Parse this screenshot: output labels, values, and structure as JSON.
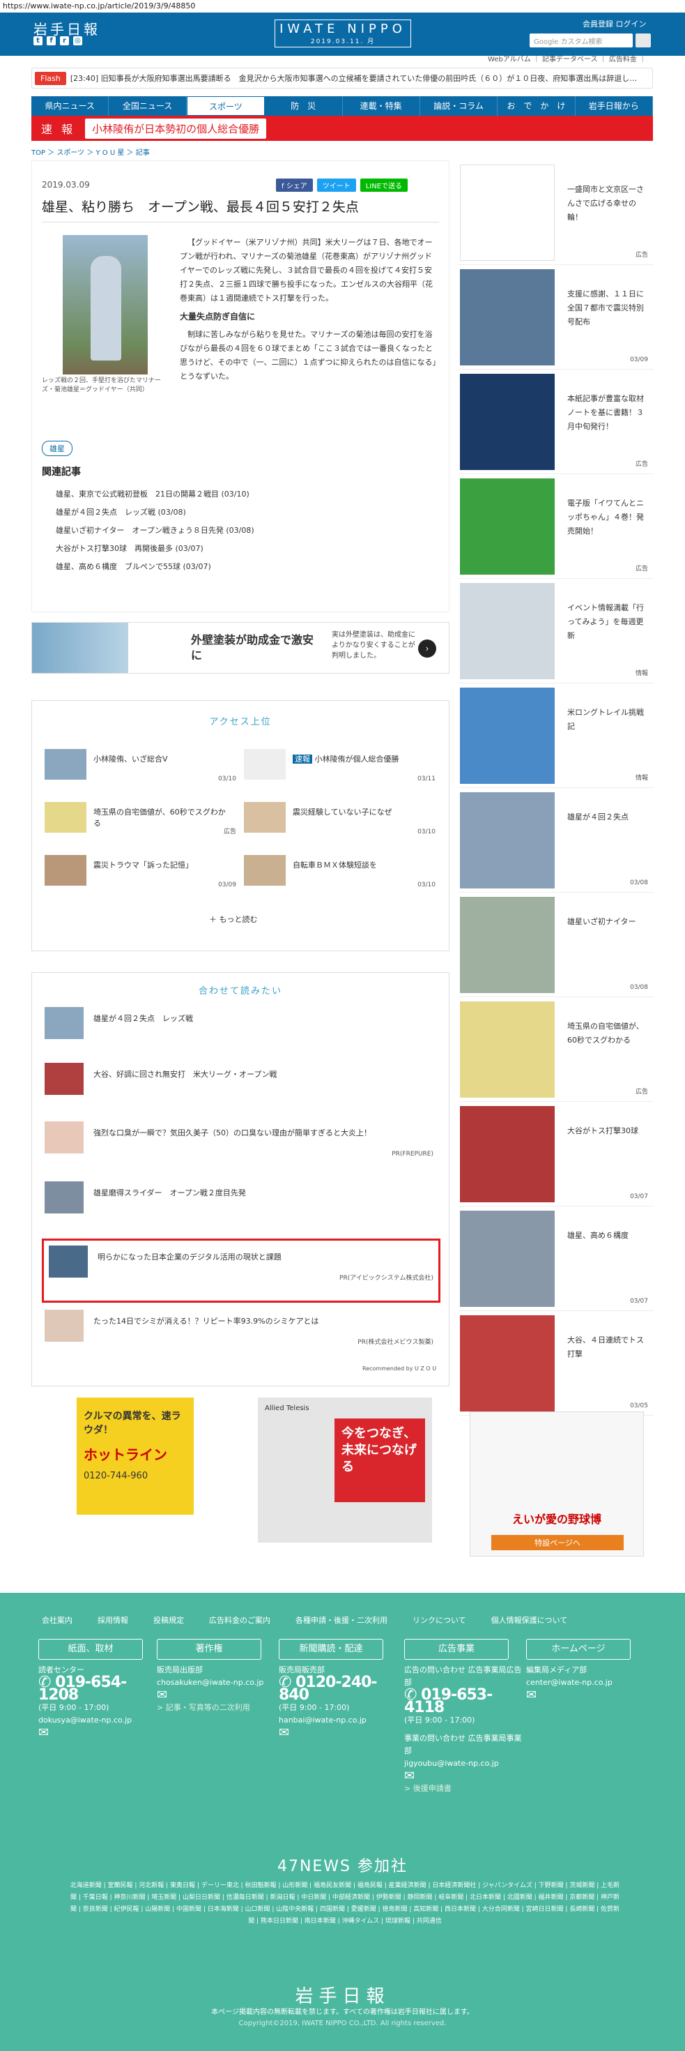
{
  "url": "https://www.iwate-np.co.jp/article/2019/3/9/48850",
  "header": {
    "logo": "岩手日報",
    "center_title": "IWATE NIPPO",
    "center_date": "2019.03.11. 月",
    "login": "会員登録  ログイン",
    "search_placeholder": "Google カスタム検索",
    "subnav": "Webアルバム ｜ 記事データベース ｜ 広告料金 ｜"
  },
  "flash": {
    "tag": "Flash",
    "text": "[23:40] 旧知事長が大阪府知事選出馬要請断る　金見沢から大阪市知事選への立候補を要請されていた俳優の前田吟氏（６０）が１０日夜、府知事選出馬は辞退し…"
  },
  "nav": [
    "県内ニュース",
    "全国ニュース",
    "スポーツ",
    "防　災",
    "連載・特集",
    "論説・コラム",
    "お　で　か　け",
    "岩手日報から"
  ],
  "breaking": {
    "label": "速 報",
    "text": "小林陵侑が日本勢初の個人総合優勝"
  },
  "breadcrumb": "TOP ＞ スポーツ ＞ Y O U 星 ＞ 記事",
  "article": {
    "date": "2019.03.09",
    "share": [
      "f シェア",
      "ツイート",
      "LINEで送る"
    ],
    "title": "雄星、粘り勝ち　オープン戦、最長４回５安打２失点",
    "caption": "レッズ戦の２回、手堅打を浴びたマリナーズ・菊池雄星＝グッドイヤー（共同）",
    "p1": "【グッドイヤー（米アリゾナ州）共同】米大リーグは７日、各地でオープン戦が行われ、マリナーズの菊池雄星（花巻東高）がアリゾナ州グッドイヤーでのレッズ戦に先発し、３試合目で最長の４回を投げて４安打５安打２失点、２三振１四球で勝ち投手になった。エンゼルスの大谷翔平（花巻東高）は１週間連続でトス打撃を行った。",
    "h": "大量失点防ぎ自信に",
    "p2": "制球に苦しみながら粘りを見せた。マリナーズの菊池は毎回の安打を浴びながら最長の４回を６０球でまとめ「ここ３試合では一番良くなったと思うけど、その中で（一、二回に）１点ずつに抑えられたのは自信になる」とうなずいた。",
    "tag": "雄星",
    "related_head": "関連記事",
    "related": [
      "雄星、東京で公式戦初登板　21日の開幕２戦目 (03/10)",
      "雄星が４回２失点　レッズ戦 (03/08)",
      "雄星いざ初ナイター　オープン戦きょう８日先発 (03/08)",
      "大谷がトス打撃30球　再開後最多 (03/07)",
      "雄星、高め６構度　ブルペンで55球 (03/07)"
    ]
  },
  "ad1": {
    "title": "外壁塗装が助成金で激安に",
    "desc": "実は外壁塗装は、助成金によりかなり安くすることが判明しました。",
    "label": "広告"
  },
  "ranking": {
    "title": "アクセス上位",
    "items": [
      {
        "text": "小林陵侑、いざ総合V",
        "date": "03/10"
      },
      {
        "badge": "速報",
        "text": "小林陵侑が個人総合優勝",
        "date": "03/11"
      },
      {
        "text": "埼玉県の自宅価値が、60秒でスグわかる",
        "date": "広告"
      },
      {
        "text": "震災経験していない子になぜ",
        "date": "03/10"
      },
      {
        "text": "震災トラウマ「訴った記憶」",
        "date": "03/09"
      },
      {
        "text": "自転車ＢＭＸ体験短談を",
        "date": "03/10"
      }
    ],
    "more": "もっと読む"
  },
  "recommend": {
    "title": "合わせて読みたい",
    "items": [
      {
        "text": "雄星が４回２失点　レッズ戦",
        "pr": ""
      },
      {
        "text": "大谷、好調に回され無安打　米大リーグ・オープン戦",
        "pr": ""
      },
      {
        "text": "強烈な口臭が一瞬で？気田久美子（50）の口臭ない理由が簡単すぎると大炎上！",
        "pr": "PR(FREPURE)"
      },
      {
        "text": "雄星磨得スライダー　オープン戦２度目先発",
        "pr": ""
      },
      {
        "text": "明らかになった日本企業のデジタル活用の現状と課題",
        "pr": "PR(アイビックシステム株式会社)"
      },
      {
        "text": "たった14日でシミが消える！？リピート率93.9%のシミケアとは",
        "pr": "PR(株式会社メビウス製薬)"
      }
    ],
    "powered": "Recommended by U Z O U"
  },
  "sidebar": [
    {
      "text": "一盛岡市と文京区一さんさで広げる幸せの輪！",
      "foot": "広告"
    },
    {
      "text": "支援に感謝、１１日に全国７都市で震災特別号配布",
      "foot": "03/09"
    },
    {
      "text": "本紙記事が豊富な取材ノートを基に書籍！３月中旬発行！",
      "foot": "広告"
    },
    {
      "text": "電子版「イワてんとニッポちゃん」４巻！発売開始！",
      "foot": "広告"
    },
    {
      "text": "イベント情報満載「行ってみよう」を毎週更新",
      "foot": "情報"
    },
    {
      "text": "米ロングトレイル挑戦記",
      "foot": "情報"
    },
    {
      "text": "雄星が４回２失点",
      "foot": "03/08"
    },
    {
      "text": "雄星いざ初ナイター",
      "foot": "03/08"
    },
    {
      "text": "埼玉県の自宅価値が、60秒でスグわかる",
      "foot": "広告"
    },
    {
      "text": "大谷がトス打撃30球",
      "foot": "03/07"
    },
    {
      "text": "雄星、高め６構度",
      "foot": "03/07"
    },
    {
      "text": "大谷、４日連続でトス打撃",
      "foot": "03/05"
    }
  ],
  "bottom_ads": [
    {
      "title": "クルマの異常を、速ラウダ！",
      "sub": "ホットライン",
      "tel": "0120-744-960"
    },
    {
      "title": "今をつなぎ、未来につなげる",
      "sub": "Allied Telesis"
    },
    {
      "title": "えいが愛の野球博",
      "sub": "特設ページへ"
    }
  ],
  "footer": {
    "links": [
      "会社案内",
      "採用情報",
      "投稿規定",
      "広告料金のご案内",
      "各種申請・後援・二次利用",
      "リンクについて",
      "個人情報保護について"
    ],
    "buttons": [
      "紙面、取材",
      "著作権",
      "新聞購読・配達",
      "広告事業",
      "ホームページ"
    ],
    "cols": [
      {
        "label": "読者センター",
        "tel": "019-654-1208",
        "hours": "(平日 9:00 - 17:00)",
        "mail": "dokusya@iwate-np.co.jp"
      },
      {
        "label": "販売局出版部",
        "mail": "chosakuken@iwate-np.co.jp",
        "link": "> 記事・写真等の二次利用"
      },
      {
        "label": "販売局販売部",
        "tel": "0120-240-840",
        "hours": "(平日 9:00 - 17:00)",
        "mail": "hanbai@iwate-np.co.jp"
      },
      {
        "label": "広告の問い合わせ 広告事業局広告部",
        "tel": "019-653-4118",
        "hours": "(平日 9:00 - 17:00)",
        "label2": "事業の問い合わせ 広告事業局事業部",
        "mail": "jigyoubu@iwate-np.co.jp",
        "link": "> 後援申請書"
      },
      {
        "label": "編集局メディア部",
        "mail": "center@iwate-np.co.jp"
      }
    ],
    "news47": "47NEWS 参加社",
    "papers": "北海道新聞 | 室蘭民報 | 河北新報 | 東奥日報 | デーリー東北 | 秋田魁新報 | 山形新聞 | 福島民友新聞 | 福島民報 | 産業経済新聞 | 日本経済新聞社 | ジャパンタイムズ | 下野新聞 | 茨城新聞 | 上毛新聞 | 千葉日報 | 神奈川新聞 | 埼玉新聞 | 山梨日日新聞 | 信濃毎日新聞 | 新潟日報 | 中日新聞 | 中部経済新聞 | 伊勢新聞 | 静岡新聞 | 岐阜新聞 | 北日本新聞 | 北國新聞 | 福井新聞 | 京都新聞 | 神戸新聞 | 奈良新聞 | 紀伊民報 | 山陽新聞 | 中国新聞 | 日本海新聞 | 山口新聞 | 山陰中央新報 | 四国新聞 | 愛媛新聞 | 徳島新聞 | 高知新聞 | 西日本新聞 | 大分合同新聞 | 宮崎日日新聞 | 長崎新聞 | 佐賀新聞 | 熊本日日新聞 | 南日本新聞 | 沖縄タイムス | 琉球新報 | 共同通信",
    "logo": "岩手日報",
    "note": "本ページ掲載内容の無断転載を禁じます。すべての著作権は岩手日報社に属します。",
    "copyright": "Copyright©2019, IWATE NIPPO CO.,LTD. All rights reserved."
  }
}
